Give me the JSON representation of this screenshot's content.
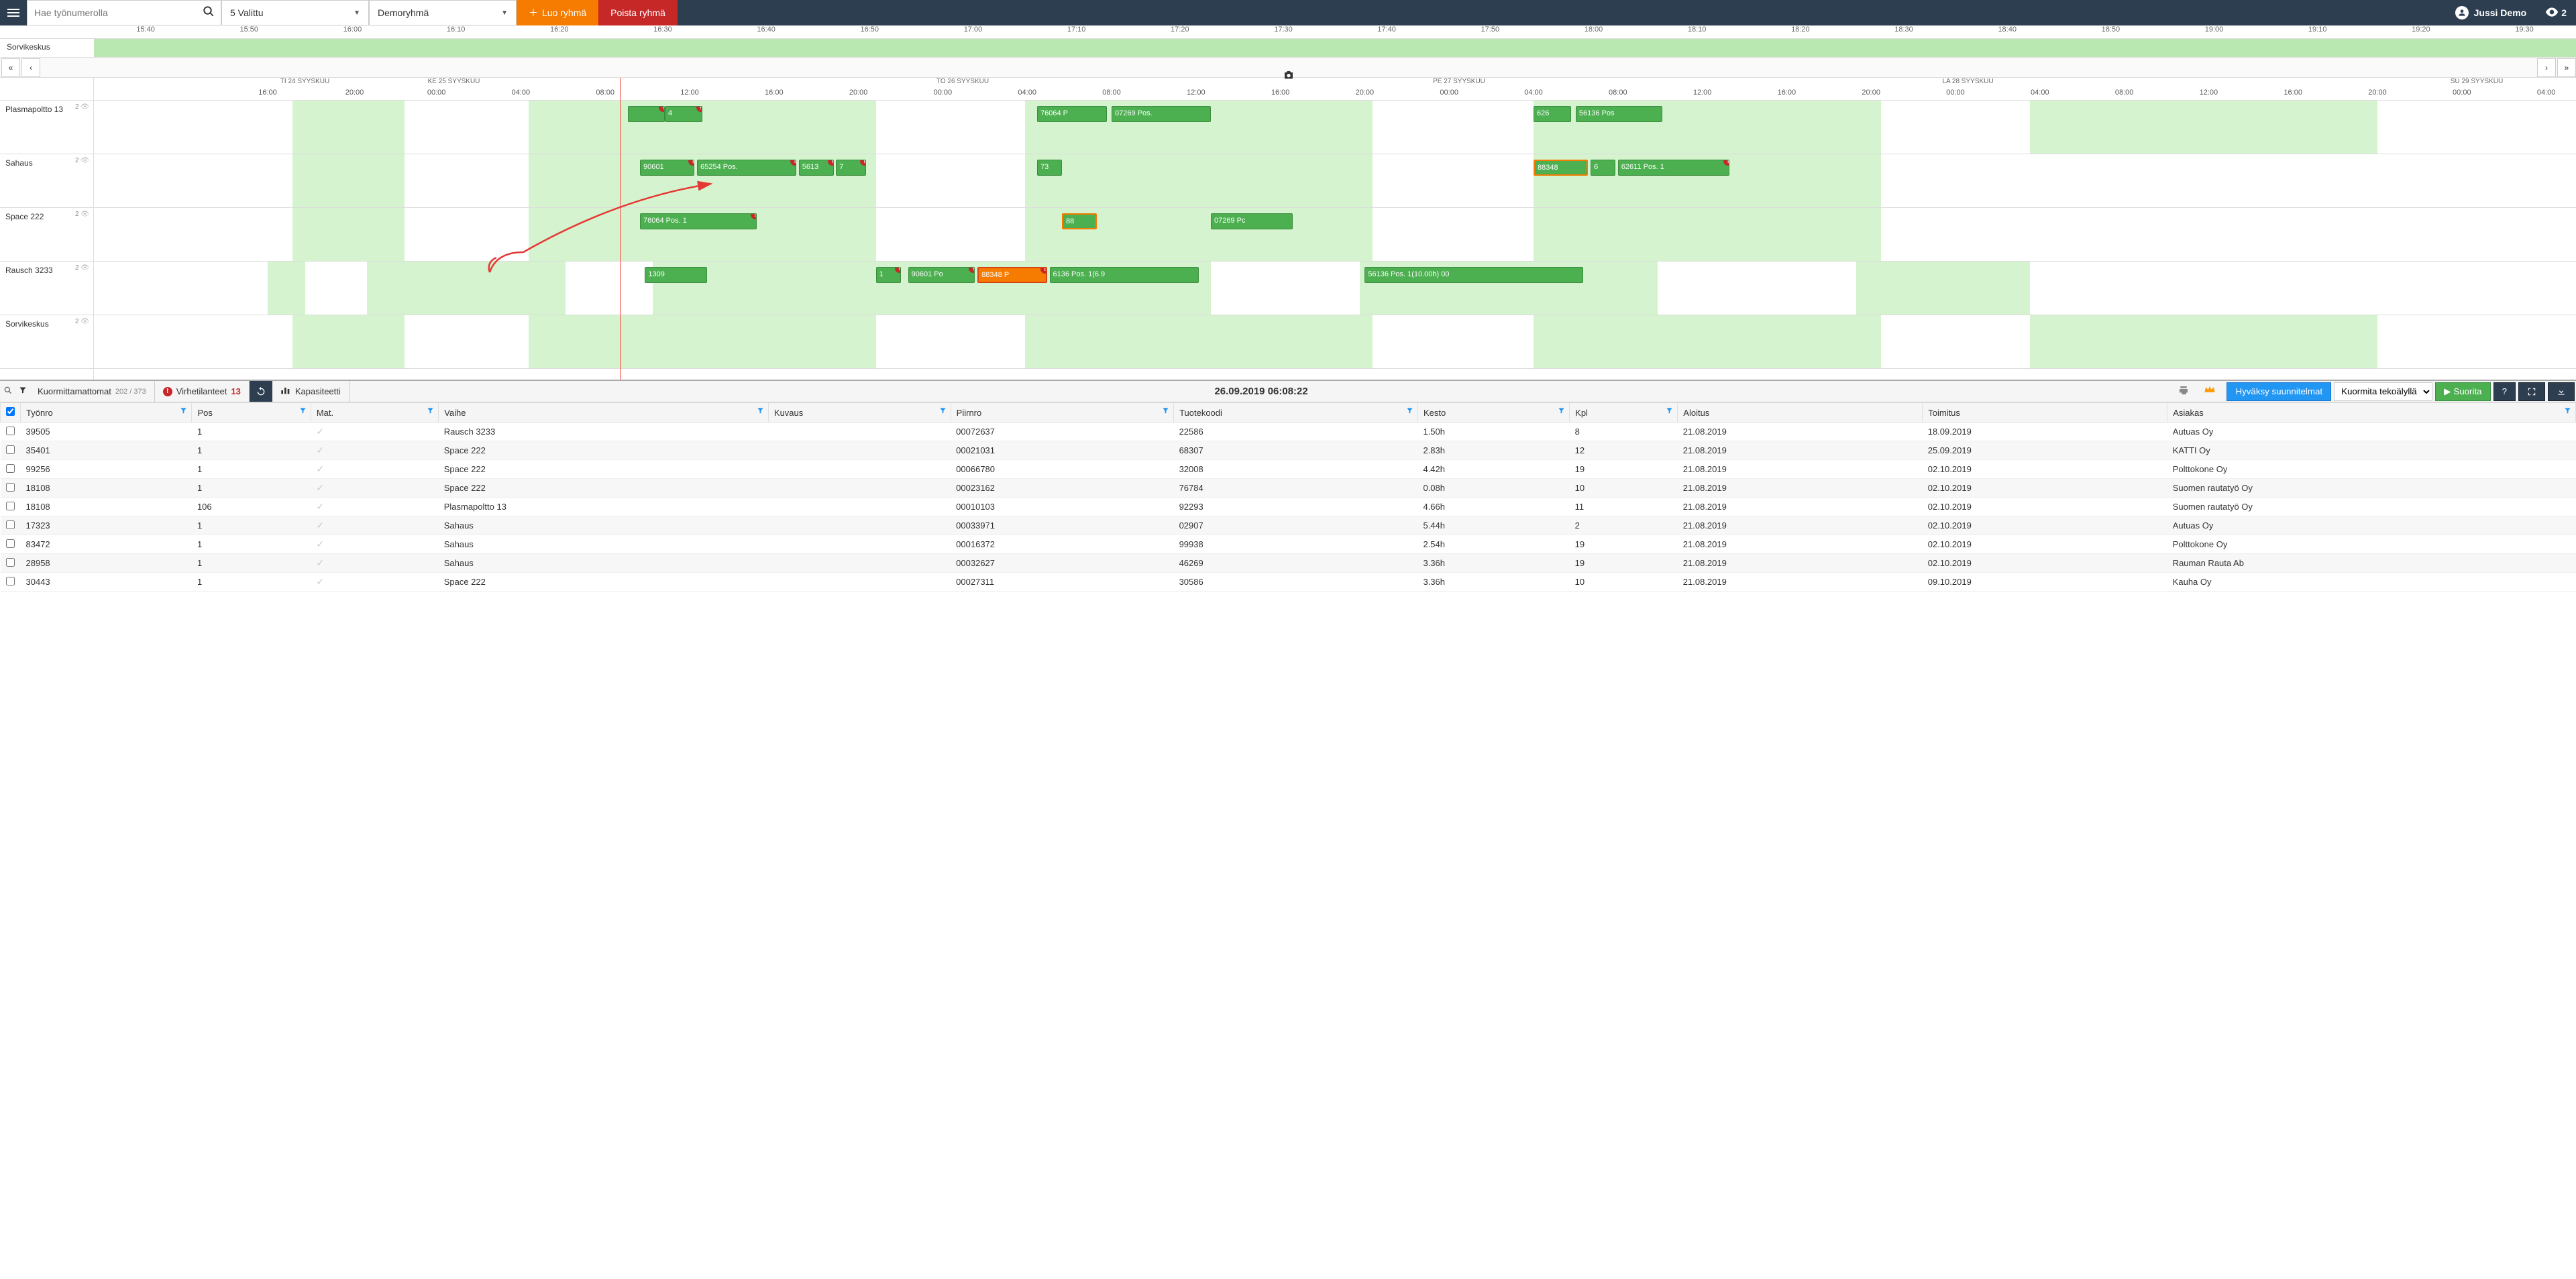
{
  "header": {
    "search_placeholder": "Hae työnumerolla",
    "selected_label": "5 Valittu",
    "group_label": "Demoryhmä",
    "create_group": "Luo ryhmä",
    "delete_group": "Poista ryhmä",
    "user": "Jussi Demo",
    "watchers": "2"
  },
  "fine_timeline": {
    "label": "Sorvikeskus",
    "ticks": [
      "15:40",
      "15:50",
      "16:00",
      "16:10",
      "16:20",
      "16:30",
      "16:40",
      "16:50",
      "17:00",
      "17:10",
      "17:20",
      "17:30",
      "17:40",
      "17:50",
      "18:00",
      "18:10",
      "18:20",
      "18:30",
      "18:40",
      "18:50",
      "19:00",
      "19:10",
      "19:20",
      "19:30"
    ]
  },
  "days": [
    {
      "label": "TI 24 SYYSKUU",
      "pct": 8.5
    },
    {
      "label": "KE 25 SYYSKUU",
      "pct": 14.5
    },
    {
      "label": "TO 26 SYYSKUU",
      "pct": 35
    },
    {
      "label": "PE 27 SYYSKUU",
      "pct": 55
    },
    {
      "label": "LA 28 SYYSKUU",
      "pct": 75.5
    },
    {
      "label": "SU 29 SYYSKUU",
      "pct": 96
    }
  ],
  "hours": [
    {
      "t": "16:00",
      "pct": 7
    },
    {
      "t": "20:00",
      "pct": 10.5
    },
    {
      "t": "00:00",
      "pct": 13.8
    },
    {
      "t": "04:00",
      "pct": 17.2
    },
    {
      "t": "08:00",
      "pct": 20.6
    },
    {
      "t": "12:00",
      "pct": 24
    },
    {
      "t": "16:00",
      "pct": 27.4
    },
    {
      "t": "20:00",
      "pct": 30.8
    },
    {
      "t": "00:00",
      "pct": 34.2
    },
    {
      "t": "04:00",
      "pct": 37.6
    },
    {
      "t": "08:00",
      "pct": 41
    },
    {
      "t": "12:00",
      "pct": 44.4
    },
    {
      "t": "16:00",
      "pct": 47.8
    },
    {
      "t": "20:00",
      "pct": 51.2
    },
    {
      "t": "00:00",
      "pct": 54.6
    },
    {
      "t": "04:00",
      "pct": 58
    },
    {
      "t": "08:00",
      "pct": 61.4
    },
    {
      "t": "12:00",
      "pct": 64.8
    },
    {
      "t": "16:00",
      "pct": 68.2
    },
    {
      "t": "20:00",
      "pct": 71.6
    },
    {
      "t": "00:00",
      "pct": 75
    },
    {
      "t": "04:00",
      "pct": 78.4
    },
    {
      "t": "08:00",
      "pct": 81.8
    },
    {
      "t": "12:00",
      "pct": 85.2
    },
    {
      "t": "16:00",
      "pct": 88.6
    },
    {
      "t": "20:00",
      "pct": 92
    },
    {
      "t": "00:00",
      "pct": 95.4
    },
    {
      "t": "04:00",
      "pct": 98.8
    }
  ],
  "nowline_pct": 21.2,
  "resources": [
    {
      "name": "Plasmapoltto 13",
      "count": "2",
      "shifts": [
        {
          "l": 8,
          "w": 4.5
        },
        {
          "l": 17.5,
          "w": 14
        },
        {
          "l": 37.5,
          "w": 14
        },
        {
          "l": 58,
          "w": 14
        },
        {
          "l": 78,
          "w": 14
        }
      ],
      "tasks": [
        {
          "l": 21.5,
          "w": 1.5,
          "text": "",
          "err": true
        },
        {
          "l": 23,
          "w": 1.5,
          "text": "4",
          "err": true
        },
        {
          "l": 38,
          "w": 2.8,
          "text": "76064 P"
        },
        {
          "l": 41,
          "w": 4,
          "text": "07269 Pos."
        },
        {
          "l": 58,
          "w": 1.5,
          "text": "626"
        },
        {
          "l": 59.7,
          "w": 3.5,
          "text": "56136 Pos"
        }
      ]
    },
    {
      "name": "Sahaus",
      "count": "2",
      "shifts": [
        {
          "l": 8,
          "w": 4.5
        },
        {
          "l": 17.5,
          "w": 14
        },
        {
          "l": 37.5,
          "w": 14
        },
        {
          "l": 58,
          "w": 14
        }
      ],
      "tasks": [
        {
          "l": 22,
          "w": 2.2,
          "text": "90601",
          "err": true
        },
        {
          "l": 24.3,
          "w": 4,
          "text": "65254 Pos.",
          "err": true
        },
        {
          "l": 28.4,
          "w": 1.4,
          "text": "5613",
          "err": true
        },
        {
          "l": 29.9,
          "w": 1.2,
          "text": "7",
          "err": true
        },
        {
          "l": 38,
          "w": 1,
          "text": "73"
        },
        {
          "l": 58,
          "w": 2.2,
          "text": "88348",
          "sel": true
        },
        {
          "l": 60.3,
          "w": 1,
          "text": "6"
        },
        {
          "l": 61.4,
          "w": 4.5,
          "text": "62611 Pos. 1",
          "err": true
        }
      ]
    },
    {
      "name": "Space 222",
      "count": "2",
      "shifts": [
        {
          "l": 8,
          "w": 4.5
        },
        {
          "l": 17.5,
          "w": 14
        },
        {
          "l": 37.5,
          "w": 14
        },
        {
          "l": 58,
          "w": 14
        }
      ],
      "tasks": [
        {
          "l": 22,
          "w": 4.7,
          "text": "76064 Pos. 1",
          "err": true
        },
        {
          "l": 39,
          "w": 1.4,
          "text": "88",
          "sel": true
        },
        {
          "l": 45,
          "w": 3.3,
          "text": "07269 Pc"
        }
      ]
    },
    {
      "name": "Rausch 3233",
      "count": "2",
      "shifts": [
        {
          "l": 7,
          "w": 1.5
        },
        {
          "l": 11,
          "w": 8
        },
        {
          "l": 22.5,
          "w": 22.5
        },
        {
          "l": 51,
          "w": 12
        },
        {
          "l": 71,
          "w": 7
        }
      ],
      "tasks": [
        {
          "l": 22.2,
          "w": 2.5,
          "text": "1309"
        },
        {
          "l": 31.5,
          "w": 1,
          "text": "1",
          "err": true
        },
        {
          "l": 32.8,
          "w": 2.7,
          "text": "90601 Po",
          "err": true
        },
        {
          "l": 35.6,
          "w": 2.8,
          "text": "88348 P",
          "orange": true,
          "err": true
        },
        {
          "l": 38.5,
          "w": 6,
          "text": "6136 Pos. 1(6.9"
        },
        {
          "l": 51.2,
          "w": 8.8,
          "text": "56136 Pos. 1(10.00h) 00"
        }
      ]
    },
    {
      "name": "Sorvikeskus",
      "count": "2",
      "shifts": [
        {
          "l": 8,
          "w": 4.5
        },
        {
          "l": 17.5,
          "w": 14
        },
        {
          "l": 37.5,
          "w": 14
        },
        {
          "l": 58,
          "w": 14
        },
        {
          "l": 78,
          "w": 14
        }
      ],
      "tasks": []
    }
  ],
  "bottom": {
    "unloaded": "Kuormittamattomat",
    "unloaded_count": "202 / 373",
    "errors": "Virhetilanteet",
    "errors_count": "13",
    "capacity": "Kapasiteetti",
    "timestamp": "26.09.2019 06:08:22",
    "approve": "Hyväksy suunnitelmat",
    "ai_load": "Kuormita tekoälyllä",
    "execute": "Suorita"
  },
  "table": {
    "headers": [
      "Työnro",
      "Pos",
      "Mat.",
      "Vaihe",
      "Kuvaus",
      "Piirnro",
      "Tuotekoodi",
      "Kesto",
      "Kpl",
      "Aloitus",
      "Toimitus",
      "Asiakas"
    ],
    "rows": [
      {
        "tyonro": "39505",
        "pos": "1",
        "vaihe": "Rausch 3233",
        "piirnro": "00072637",
        "tuote": "22586",
        "kesto": "1.50h",
        "kpl": "8",
        "aloitus": "21.08.2019",
        "toimitus": "18.09.2019",
        "asiakas": "Autuas Oy"
      },
      {
        "tyonro": "35401",
        "pos": "1",
        "vaihe": "Space 222",
        "piirnro": "00021031",
        "tuote": "68307",
        "kesto": "2.83h",
        "kpl": "12",
        "aloitus": "21.08.2019",
        "toimitus": "25.09.2019",
        "asiakas": "KATTI Oy"
      },
      {
        "tyonro": "99256",
        "pos": "1",
        "vaihe": "Space 222",
        "piirnro": "00066780",
        "tuote": "32008",
        "kesto": "4.42h",
        "kpl": "19",
        "aloitus": "21.08.2019",
        "toimitus": "02.10.2019",
        "asiakas": "Polttokone Oy"
      },
      {
        "tyonro": "18108",
        "pos": "1",
        "vaihe": "Space 222",
        "piirnro": "00023162",
        "tuote": "76784",
        "kesto": "0.08h",
        "kpl": "10",
        "aloitus": "21.08.2019",
        "toimitus": "02.10.2019",
        "asiakas": "Suomen rautatyö Oy"
      },
      {
        "tyonro": "18108",
        "pos": "106",
        "vaihe": "Plasmapoltto 13",
        "piirnro": "00010103",
        "tuote": "92293",
        "kesto": "4.66h",
        "kpl": "11",
        "aloitus": "21.08.2019",
        "toimitus": "02.10.2019",
        "asiakas": "Suomen rautatyö Oy"
      },
      {
        "tyonro": "17323",
        "pos": "1",
        "vaihe": "Sahaus",
        "piirnro": "00033971",
        "tuote": "02907",
        "kesto": "5.44h",
        "kpl": "2",
        "aloitus": "21.08.2019",
        "toimitus": "02.10.2019",
        "asiakas": "Autuas Oy"
      },
      {
        "tyonro": "83472",
        "pos": "1",
        "vaihe": "Sahaus",
        "piirnro": "00016372",
        "tuote": "99938",
        "kesto": "2.54h",
        "kpl": "19",
        "aloitus": "21.08.2019",
        "toimitus": "02.10.2019",
        "asiakas": "Polttokone Oy"
      },
      {
        "tyonro": "28958",
        "pos": "1",
        "vaihe": "Sahaus",
        "piirnro": "00032627",
        "tuote": "46269",
        "kesto": "3.36h",
        "kpl": "19",
        "aloitus": "21.08.2019",
        "toimitus": "02.10.2019",
        "asiakas": "Rauman Rauta Ab"
      },
      {
        "tyonro": "30443",
        "pos": "1",
        "vaihe": "Space 222",
        "piirnro": "00027311",
        "tuote": "30586",
        "kesto": "3.36h",
        "kpl": "10",
        "aloitus": "21.08.2019",
        "toimitus": "09.10.2019",
        "asiakas": "Kauha Oy"
      }
    ]
  }
}
